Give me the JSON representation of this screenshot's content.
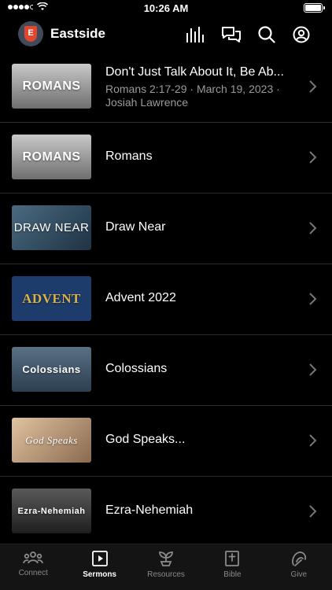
{
  "status": {
    "time": "10:26 AM"
  },
  "header": {
    "title": "Eastside",
    "logo_letter": "E"
  },
  "sermons": [
    {
      "title": "Don't Just Talk About It, Be Ab...",
      "subtitle": "Romans 2:17-29 · March 19, 2023 ·",
      "speaker": "Josiah Lawrence",
      "thumb_text": "ROMANS",
      "thumb_color": "#9a9a9a"
    },
    {
      "title": "Romans",
      "thumb_text": "ROMANS",
      "thumb_color": "#9a9a9a"
    },
    {
      "title": "Draw Near",
      "thumb_text": "DRAW NEAR",
      "thumb_color": "#304a5c"
    },
    {
      "title": "Advent 2022",
      "thumb_text": "ADVENT",
      "thumb_color": "#1d3c6b"
    },
    {
      "title": "Colossians",
      "thumb_text": "Colossians",
      "thumb_color": "#3c5266"
    },
    {
      "title": "God Speaks...",
      "thumb_text": "God Speaks",
      "thumb_color": "#b59270"
    },
    {
      "title": "Ezra-Nehemiah",
      "thumb_text": "Ezra-Nehemiah",
      "thumb_color": "#3a3a3a"
    }
  ],
  "tabs": [
    {
      "label": "Connect",
      "icon": "people-icon"
    },
    {
      "label": "Sermons",
      "icon": "play-icon",
      "active": true
    },
    {
      "label": "Resources",
      "icon": "sprout-icon"
    },
    {
      "label": "Bible",
      "icon": "bible-icon"
    },
    {
      "label": "Give",
      "icon": "give-icon"
    }
  ]
}
